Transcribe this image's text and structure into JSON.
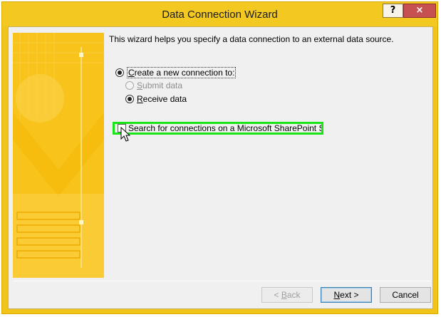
{
  "window": {
    "title": "Data Connection Wizard"
  },
  "titlebar": {
    "help_label": "?",
    "close_label": "×"
  },
  "intro_text": "This wizard helps you specify a data connection to an external data source.",
  "options": {
    "create_new": {
      "prefix": "",
      "accel": "C",
      "rest": "reate a new connection to:",
      "selected": true
    },
    "submit_data": {
      "accel": "S",
      "rest": "ubmit data",
      "selected": false,
      "enabled": false
    },
    "receive_data": {
      "accel": "R",
      "rest": "eceive data",
      "selected": true,
      "enabled": true
    },
    "search_sharepoint": {
      "label": "Search for connections on a Microsoft SharePoint Server",
      "checked": false
    }
  },
  "buttons": {
    "back": {
      "prefix": "< ",
      "accel": "B",
      "rest": "ack",
      "enabled": false
    },
    "next": {
      "accel": "N",
      "rest": "ext >",
      "enabled": true
    },
    "cancel": {
      "label": "Cancel",
      "enabled": true
    }
  },
  "colors": {
    "titlebar": "#f3c821",
    "highlight": "#19e519",
    "banner": "#f7c11a",
    "close": "#c75050"
  },
  "icons": [
    "question-icon",
    "close-icon",
    "mouse-pointer-icon"
  ]
}
